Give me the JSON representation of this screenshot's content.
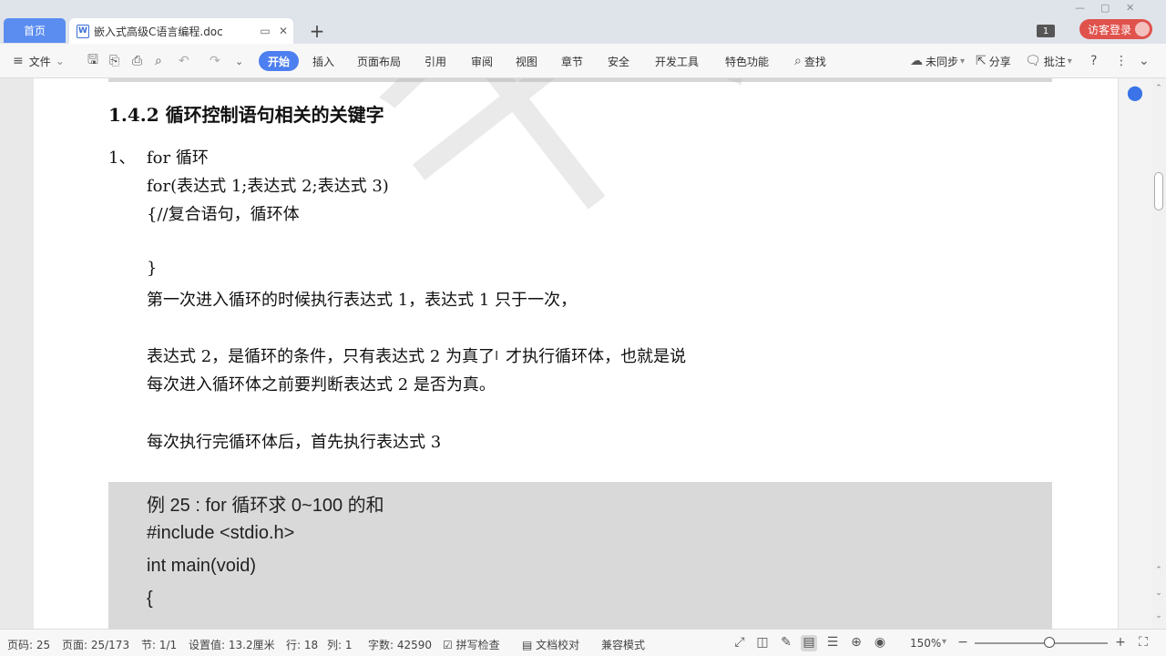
{
  "tabs": {
    "home_label": "首页",
    "doc_title": "嵌入式高级C语言编程.doc",
    "doc_icon": "W",
    "badge_count": "1",
    "login_label": "访客登录"
  },
  "menu": {
    "file": "文件",
    "start": "开始",
    "items": [
      "插入",
      "页面布局",
      "引用",
      "审阅",
      "视图",
      "章节",
      "安全",
      "开发工具",
      "特色功能"
    ],
    "find": "查找",
    "sync": "未同步",
    "share": "分享",
    "annotate": "批注"
  },
  "document": {
    "heading": "1.4.2  循环控制语句相关的关键字",
    "item_number": "1、",
    "lines": [
      "for  循环",
      "for(表达式 1;表达式 2;表达式 3)",
      "{//复合语句，循环体",
      "}",
      "第一次进入循环的时候执行表达式 1，表达式 1 只于一次，",
      "表达式 2，是循环的条件，只有表达式 2 为真了",
      "才执行循环体，也就是说",
      "每次进入循环体之前要判断表达式 2 是否为真。",
      "每次执行完循环体后，首先执行表达式 3"
    ],
    "code": [
      "例 25 : for 循环求 0~100  的和",
      "#include <stdio.h>",
      "int main(void)",
      "{"
    ],
    "watermark": "千锋教"
  },
  "status": {
    "page_code": "页码: 25",
    "page": "页面: 25/173",
    "section": "节: 1/1",
    "setting": "设置值: 13.2厘米",
    "row": "行: 18",
    "col": "列: 1",
    "word_count": "字数: 42590",
    "spell": "拼写检查",
    "proof": "文档校对",
    "compat": "兼容模式",
    "zoom": "150%"
  },
  "colors": {
    "accent": "#4d7ff0",
    "login": "#e0524c",
    "code_bg": "#d9d9d9"
  }
}
